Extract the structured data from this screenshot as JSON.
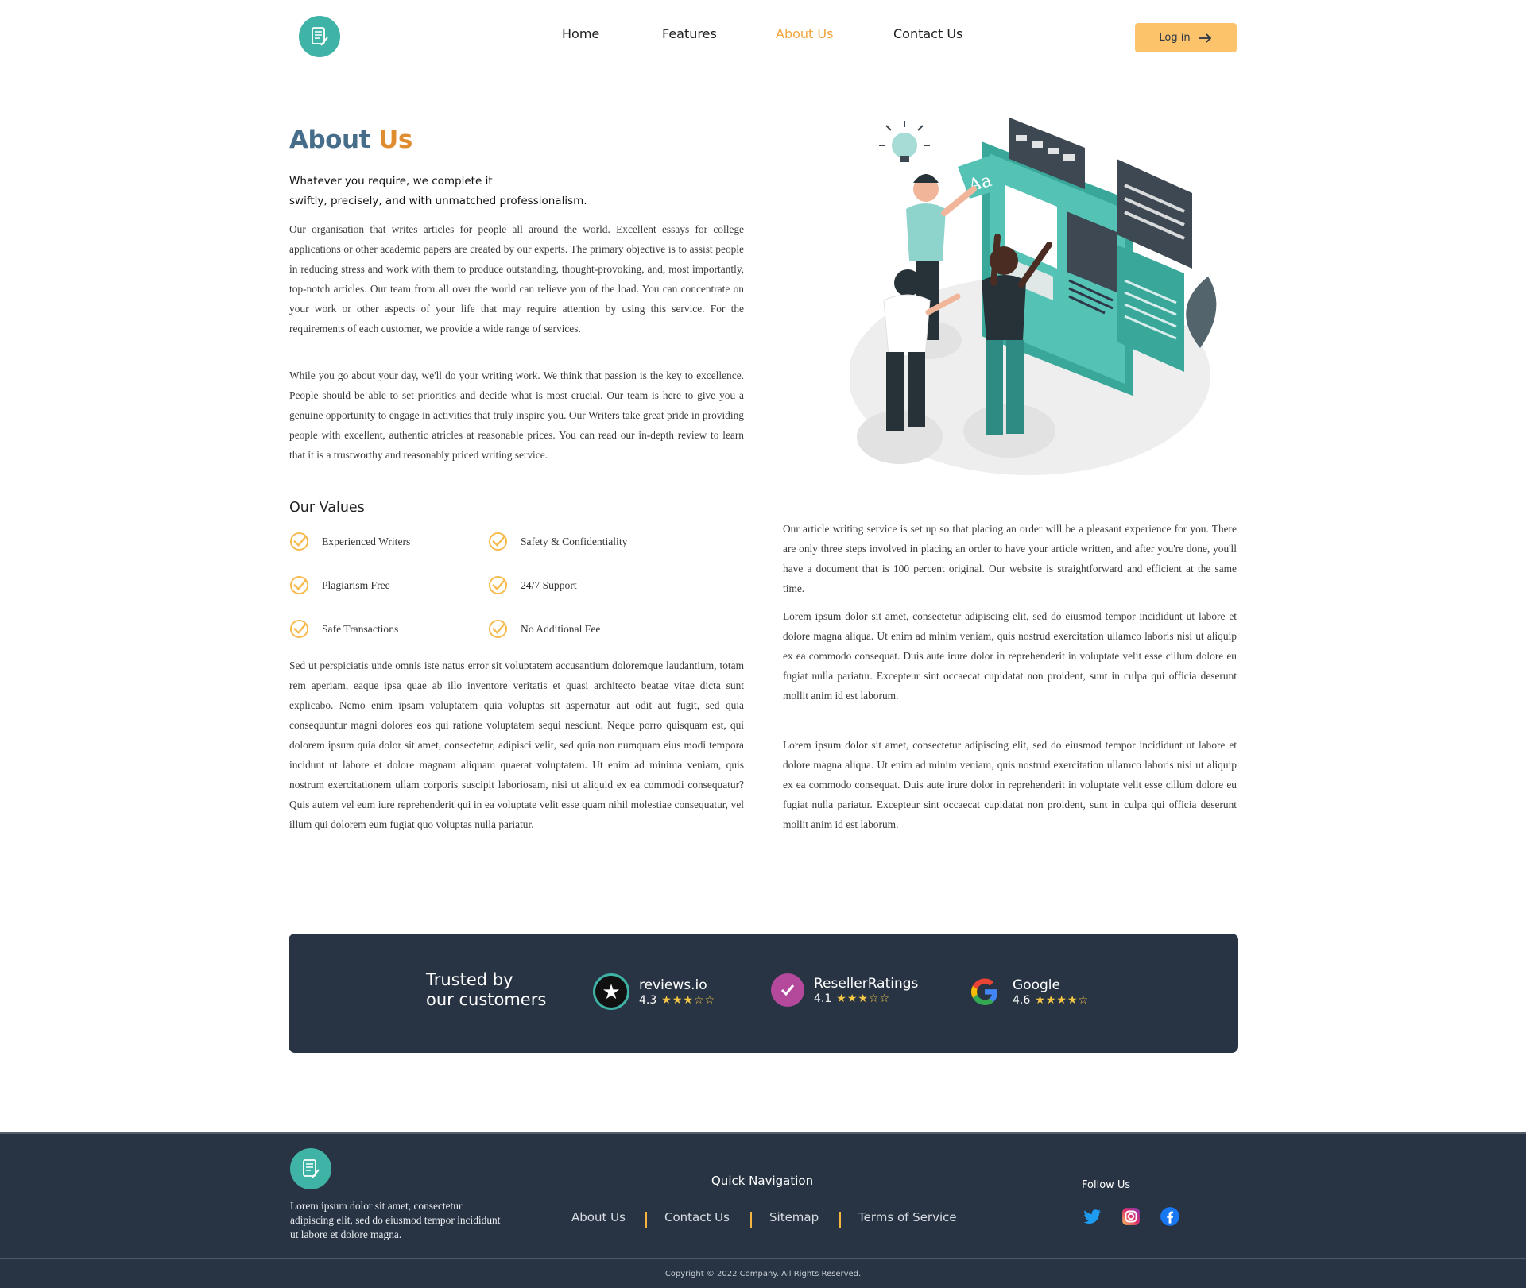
{
  "nav": {
    "items": [
      "Home",
      "Features",
      "About Us",
      "Contact Us"
    ],
    "active": "About Us",
    "login_label": "Log in"
  },
  "about": {
    "title_part1": "About",
    "title_part2": "Us",
    "tagline_line1": "Whatever you require, we complete it",
    "tagline_line2": "swiftly, precisely, and with unmatched professionalism.",
    "para1": "Our organisation that writes articles for people all around the world. Excellent essays for college applications or other academic papers are created by our experts. The primary objective is to assist people in reducing stress and work with them to produce outstanding, thought-provoking, and, most importantly, top-notch articles. Our team  from all over the world can relieve you of the load. You can concentrate on your work or other aspects of your life that may require attention by using this service. For the requirements of each customer, we provide a wide range of services.",
    "para2": "While you go about your day, we'll do your writing work. We think that passion is the key to excellence. People should be able to set priorities and decide what is most crucial. Our team is here to give you a genuine opportunity to engage in activities that truly inspire you. Our Writers take great pride in providing people with excellent, authentic atricles at reasonable prices.  You can read our in-depth review to learn that it is a trustworthy and reasonably priced writing service.",
    "values_title": "Our Values",
    "values": [
      "Experienced Writers",
      "Safety & Confidentiality",
      "Plagiarism Free",
      "24/7 Support",
      "Safe Transactions",
      "No Additional Fee"
    ],
    "para3": "Sed ut perspiciatis unde omnis iste natus error sit voluptatem accusantium doloremque laudantium, totam rem aperiam, eaque ipsa quae ab illo inventore veritatis et quasi architecto beatae vitae dicta sunt explicabo. Nemo enim ipsam voluptatem quia voluptas sit aspernatur aut odit aut fugit, sed quia consequuntur magni dolores eos qui ratione voluptatem sequi nesciunt. Neque porro quisquam est, qui dolorem ipsum quia dolor sit amet, consectetur, adipisci velit, sed quia non numquam eius modi tempora incidunt ut labore et dolore magnam aliquam quaerat voluptatem. Ut enim ad minima veniam, quis nostrum exercitationem ullam corporis suscipit laboriosam, nisi ut aliquid ex ea commodi consequatur? Quis autem vel eum iure reprehenderit qui in ea voluptate velit esse quam nihil molestiae consequatur, vel illum qui dolorem eum fugiat quo voluptas nulla pariatur.",
    "right_para1": "Our article writing service is set up so that placing an order will be a pleasant experience for you. There are only three steps involved in placing an order to have your article written, and after you're done, you'll have a document that is 100 percent original. Our website is straightforward and efficient at the same time.",
    "right_para2": "Lorem ipsum dolor sit amet, consectetur adipiscing elit, sed do eiusmod tempor incididunt ut labore et dolore magna aliqua. Ut enim ad minim veniam, quis nostrud exercitation ullamco laboris nisi ut aliquip ex ea commodo consequat. Duis aute irure dolor in reprehenderit in voluptate velit esse cillum dolore eu fugiat nulla pariatur. Excepteur sint occaecat cupidatat non proident, sunt in culpa qui officia deserunt mollit anim id est laborum.",
    "right_para3": "Lorem ipsum dolor sit amet, consectetur adipiscing elit, sed do eiusmod tempor incididunt ut labore et dolore magna aliqua. Ut enim ad minim veniam, quis nostrud exercitation ullamco laboris nisi ut aliquip ex ea commodo consequat. Duis aute irure dolor in reprehenderit in voluptate velit esse cillum dolore eu fugiat nulla pariatur. Excepteur sint occaecat cupidatat non proident, sunt in culpa qui officia deserunt mollit anim id est laborum."
  },
  "trusted": {
    "title_line1": "Trusted by",
    "title_line2": "our customers",
    "ratings": [
      {
        "name": "reviews.io",
        "score": "4.3",
        "stars": "★★★☆☆",
        "icon": "reviews-io-icon"
      },
      {
        "name": "ResellerRatings",
        "score": "4.1",
        "stars": "★★★☆☆",
        "icon": "reseller-ratings-icon"
      },
      {
        "name": "Google",
        "score": "4.6",
        "stars": "★★★★☆",
        "icon": "google-icon"
      }
    ]
  },
  "footer": {
    "description": "Lorem ipsum dolor sit amet, consectetur adipiscing elit, sed do eiusmod tempor incididunt ut labore et dolore magna.",
    "quick_nav_title": "Quick Navigation",
    "links": [
      "About Us",
      "Contact Us",
      "Sitemap",
      "Terms of Service"
    ],
    "follow_title": "Follow Us",
    "social": [
      "twitter-icon",
      "instagram-icon",
      "facebook-icon"
    ],
    "copyright": "Copyright © 2022 Company. All Rights Reserved."
  },
  "colors": {
    "brand_teal": "#3fb3a6",
    "accent_orange": "#f2a53a",
    "button_yellow": "#fcc36b",
    "dark_navy": "#283444",
    "title_blue": "#466e8a"
  }
}
